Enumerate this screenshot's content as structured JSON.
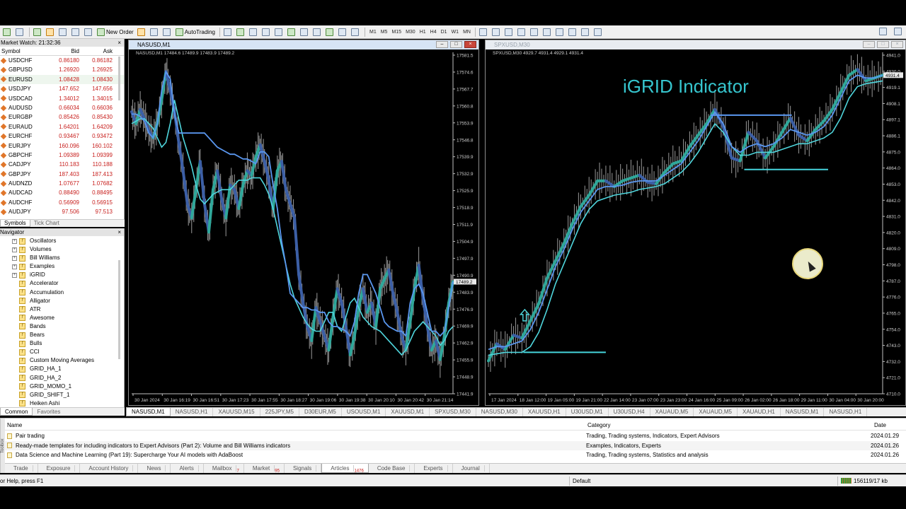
{
  "toolbar": {
    "new_order": "New Order",
    "auto_trading": "AutoTrading",
    "timeframes": [
      "M1",
      "M5",
      "M15",
      "M30",
      "H1",
      "H4",
      "D1",
      "W1",
      "MN"
    ]
  },
  "market_watch": {
    "title": "Market Watch: 21:32:36",
    "col_symbol": "Symbol",
    "col_bid": "Bid",
    "col_ask": "Ask",
    "rows": [
      {
        "symbol": "USDCHF",
        "bid": "0.86180",
        "ask": "0.86182"
      },
      {
        "symbol": "GBPUSD",
        "bid": "1.26920",
        "ask": "1.26925"
      },
      {
        "symbol": "EURUSD",
        "bid": "1.08428",
        "ask": "1.08430"
      },
      {
        "symbol": "USDJPY",
        "bid": "147.652",
        "ask": "147.656"
      },
      {
        "symbol": "USDCAD",
        "bid": "1.34012",
        "ask": "1.34015"
      },
      {
        "symbol": "AUDUSD",
        "bid": "0.66034",
        "ask": "0.66036"
      },
      {
        "symbol": "EURGBP",
        "bid": "0.85426",
        "ask": "0.85430"
      },
      {
        "symbol": "EURAUD",
        "bid": "1.64201",
        "ask": "1.64209"
      },
      {
        "symbol": "EURCHF",
        "bid": "0.93467",
        "ask": "0.93472"
      },
      {
        "symbol": "EURJPY",
        "bid": "160.096",
        "ask": "160.102"
      },
      {
        "symbol": "GBPCHF",
        "bid": "1.09389",
        "ask": "1.09399"
      },
      {
        "symbol": "CADJPY",
        "bid": "110.183",
        "ask": "110.188"
      },
      {
        "symbol": "GBPJPY",
        "bid": "187.403",
        "ask": "187.413"
      },
      {
        "symbol": "AUDNZD",
        "bid": "1.07677",
        "ask": "1.07682"
      },
      {
        "symbol": "AUDCAD",
        "bid": "0.88490",
        "ask": "0.88495"
      },
      {
        "symbol": "AUDCHF",
        "bid": "0.56909",
        "ask": "0.56915"
      },
      {
        "symbol": "AUDJPY",
        "bid": "97.506",
        "ask": "97.513"
      }
    ],
    "tabs": [
      "Symbols",
      "Tick Chart"
    ]
  },
  "navigator": {
    "title": "Navigator",
    "items": [
      {
        "label": "Oscillators",
        "expandable": true
      },
      {
        "label": "Volumes",
        "expandable": true
      },
      {
        "label": "Bill Williams",
        "expandable": true
      },
      {
        "label": "Examples",
        "expandable": true
      },
      {
        "label": "iGRID",
        "expandable": true
      },
      {
        "label": "Accelerator",
        "expandable": false
      },
      {
        "label": "Accumulation",
        "expandable": false
      },
      {
        "label": "Alligator",
        "expandable": false
      },
      {
        "label": "ATR",
        "expandable": false
      },
      {
        "label": "Awesome",
        "expandable": false
      },
      {
        "label": "Bands",
        "expandable": false
      },
      {
        "label": "Bears",
        "expandable": false
      },
      {
        "label": "Bulls",
        "expandable": false
      },
      {
        "label": "CCI",
        "expandable": false
      },
      {
        "label": "Custom Moving Averages",
        "expandable": false
      },
      {
        "label": "GRID_HA_1",
        "expandable": false
      },
      {
        "label": "GRID_HA_2",
        "expandable": false
      },
      {
        "label": "GRID_MOMO_1",
        "expandable": false
      },
      {
        "label": "GRID_SHIFT_1",
        "expandable": false
      },
      {
        "label": "Heiken Ashi",
        "expandable": false
      }
    ],
    "tabs": [
      "Common",
      "Favorites"
    ]
  },
  "chart_left": {
    "title": "NASUSD,M1",
    "info": "NASUSD,M1  17484.6 17489.9 17483.9 17489.2",
    "current_price_label": "17489.2"
  },
  "chart_right": {
    "title": "SPXUSD,M30",
    "info": "SPXUSD,M30  4929.7 4931.4 4929.1 4931.4",
    "overlay_label": "iGRID Indicator",
    "current_price_label": "4931.4"
  },
  "chart_data": [
    {
      "type": "line",
      "symbol": "NASUSD,M1",
      "ylim": [
        17441.5,
        17585
      ],
      "y_ticks": [
        "17581.5",
        "17574.6",
        "17567.7",
        "17560.8",
        "17553.9",
        "17546.8",
        "17539.9",
        "17532.9",
        "17525.9",
        "17518.9",
        "17511.9",
        "17504.9",
        "17497.9",
        "17490.9",
        "17483.9",
        "17476.9",
        "17469.9",
        "17462.9",
        "17455.9",
        "17448.9",
        "17441.9"
      ],
      "x_ticks": [
        "30 Jan 2024",
        "30 Jan 16:19",
        "30 Jan 16:51",
        "30 Jan 17:23",
        "30 Jan 17:55",
        "30 Jan 18:27",
        "30 Jan 19:06",
        "30 Jan 19:38",
        "30 Jan 20:10",
        "30 Jan 20:42",
        "30 Jan 21:14"
      ],
      "price_x": [
        0,
        6,
        12,
        18,
        24,
        30,
        36,
        42,
        48,
        54,
        60,
        66,
        72,
        78,
        84,
        90,
        96,
        102,
        108,
        114,
        120,
        126,
        132,
        138,
        144,
        150,
        156,
        162,
        168,
        174,
        180,
        186,
        192,
        198,
        204,
        210,
        216,
        222,
        228,
        234,
        240,
        246,
        252,
        258,
        264,
        270,
        276,
        282,
        288,
        294,
        300,
        306,
        312,
        318,
        324,
        330,
        336,
        342,
        348,
        354,
        360,
        366,
        372,
        378,
        384,
        390,
        396,
        402,
        408,
        414,
        420,
        426,
        432,
        438,
        444,
        450
      ],
      "price_y": [
        17561,
        17556,
        17562,
        17558,
        17553,
        17550,
        17556,
        17566,
        17578,
        17570,
        17561,
        17548,
        17536,
        17522,
        17516,
        17528,
        17540,
        17522,
        17510,
        17528,
        17536,
        17524,
        17516,
        17530,
        17528,
        17520,
        17530,
        17536,
        17534,
        17542,
        17547,
        17540,
        17532,
        17520,
        17536,
        17540,
        17528,
        17522,
        17516,
        17492,
        17480,
        17470,
        17464,
        17478,
        17472,
        17466,
        17460,
        17474,
        17486,
        17480,
        17470,
        17458,
        17466,
        17478,
        17486,
        17476,
        17480,
        17470,
        17486,
        17490,
        17494,
        17484,
        17476,
        17466,
        17460,
        17472,
        17486,
        17496,
        17482,
        17470,
        17460,
        17464,
        17456,
        17466,
        17480,
        17489
      ],
      "band_fast": [
        17560,
        17560,
        17559,
        17557,
        17552,
        17550,
        17556,
        17570,
        17578,
        17575,
        17560,
        17552,
        17552,
        17552,
        17552,
        17552,
        17552,
        17552,
        17550,
        17548,
        17546,
        17545,
        17544,
        17543,
        17543,
        17542,
        17541,
        17541,
        17540,
        17539,
        17544,
        17544,
        17542,
        17530,
        17520,
        17506,
        17496,
        17484,
        17482,
        17480,
        17478,
        17478,
        17477,
        17477,
        17476,
        17476,
        17472,
        17470,
        17470,
        17469,
        17468,
        17466,
        17472,
        17484,
        17492,
        17492,
        17488,
        17484,
        17478,
        17472,
        17470,
        17469,
        17468,
        17468,
        17466,
        17480,
        17486,
        17488,
        17484,
        17476,
        17468,
        17468,
        17466,
        17468,
        17478,
        17489
      ],
      "band_slow": [
        17556,
        17557,
        17558,
        17558,
        17556,
        17554,
        17550,
        17546,
        17548,
        17556,
        17566,
        17558,
        17550,
        17544,
        17538,
        17530,
        17524,
        17522,
        17524,
        17526,
        17527,
        17528,
        17528,
        17528,
        17530,
        17532,
        17532,
        17532,
        17533,
        17533,
        17533,
        17530,
        17526,
        17520,
        17512,
        17504,
        17496,
        17488,
        17482,
        17478,
        17474,
        17471,
        17469,
        17468,
        17468,
        17472,
        17476,
        17476,
        17470,
        17468,
        17474,
        17480,
        17482,
        17478,
        17474,
        17472,
        17470,
        17469,
        17468,
        17466,
        17464,
        17462,
        17460,
        17458,
        17460,
        17464,
        17468,
        17470,
        17472,
        17470,
        17468,
        17466,
        17462,
        17464,
        17468,
        17470
      ]
    },
    {
      "type": "line",
      "symbol": "SPXUSD,M30",
      "ylim": [
        4707,
        4944
      ],
      "y_ticks": [
        "4941.0",
        "4930.0",
        "4919.1",
        "4908.1",
        "4897.1",
        "4886.1",
        "4875.0",
        "4864.0",
        "4853.0",
        "4842.0",
        "4831.0",
        "4820.0",
        "4809.0",
        "4798.0",
        "4787.0",
        "4776.0",
        "4765.0",
        "4754.0",
        "4743.0",
        "4732.0",
        "4721.0",
        "4710.0"
      ],
      "x_ticks": [
        "17 Jan 2024",
        "18 Jan 12:00",
        "19 Jan 05:00",
        "19 Jan 21:00",
        "22 Jan 14:00",
        "23 Jan 07:00",
        "23 Jan 23:00",
        "24 Jan 16:00",
        "25 Jan 09:00",
        "26 Jan 02:00",
        "26 Jan 18:00",
        "29 Jan 11:00",
        "30 Jan 04:00",
        "30 Jan 20:00"
      ],
      "price_x": [
        0,
        12,
        24,
        36,
        48,
        60,
        72,
        84,
        96,
        108,
        120,
        132,
        144,
        156,
        168,
        180,
        192,
        204,
        216,
        228,
        240,
        252,
        264,
        276,
        288,
        300,
        312,
        324,
        336,
        348,
        360,
        372,
        384,
        396,
        408,
        420,
        432,
        444,
        456,
        468,
        480,
        492,
        504,
        516,
        528,
        540,
        552,
        564
      ],
      "price_y": [
        4730,
        4742,
        4738,
        4748,
        4746,
        4758,
        4770,
        4788,
        4800,
        4812,
        4826,
        4838,
        4846,
        4856,
        4856,
        4852,
        4856,
        4858,
        4860,
        4855,
        4854,
        4862,
        4868,
        4870,
        4880,
        4888,
        4896,
        4906,
        4894,
        4872,
        4870,
        4890,
        4884,
        4872,
        4880,
        4890,
        4900,
        4888,
        4884,
        4892,
        4898,
        4906,
        4918,
        4930,
        4934,
        4926,
        4928,
        4930
      ],
      "band_fast": [
        4738,
        4740,
        4740,
        4742,
        4744,
        4752,
        4764,
        4780,
        4796,
        4808,
        4822,
        4834,
        4842,
        4850,
        4852,
        4852,
        4853,
        4855,
        4856,
        4856,
        4856,
        4860,
        4864,
        4868,
        4876,
        4884,
        4894,
        4904,
        4896,
        4880,
        4876,
        4880,
        4882,
        4880,
        4882,
        4886,
        4892,
        4890,
        4888,
        4890,
        4894,
        4902,
        4914,
        4926,
        4930,
        4928,
        4928,
        4930
      ],
      "band_slow": [
        4734,
        4735,
        4736,
        4736,
        4736,
        4740,
        4750,
        4766,
        4784,
        4798,
        4812,
        4826,
        4836,
        4842,
        4844,
        4846,
        4847,
        4848,
        4850,
        4851,
        4852,
        4854,
        4858,
        4862,
        4868,
        4876,
        4886,
        4896,
        4890,
        4880,
        4874,
        4874,
        4876,
        4876,
        4876,
        4878,
        4880,
        4882,
        4882,
        4884,
        4886,
        4890,
        4900,
        4914,
        4922,
        4924,
        4925,
        4926
      ],
      "grid_lines": [
        {
          "y": 4902,
          "x_from": 318,
          "x_to": 434,
          "color": "#5a97f0"
        },
        {
          "y": 4864,
          "x_from": 366,
          "x_to": 486,
          "color": "#46d4dc"
        },
        {
          "y": 4736,
          "x_from": 50,
          "x_to": 168,
          "color": "#46d4dc"
        }
      ],
      "arrow": {
        "y": 4760,
        "x": 52
      }
    }
  ],
  "chart_tabs": [
    "NASUSD,M1",
    "NASUSD,H1",
    "XAUUSD,M15",
    "225JPY,M5",
    "D30EUR,M5",
    "USOUSD,M1",
    "XAUUSD,M1",
    "SPXUSD,M30",
    "NASUSD,M30",
    "XAUUSD,H1",
    "U30USD,M1",
    "U30USD,H4",
    "XAUAUD,M5",
    "XAUAUD,M5",
    "XAUAUD,H1",
    "NASUSD,M1",
    "NASUSD,H1"
  ],
  "toolbox": {
    "side_label": "Toolbox",
    "col_name": "Name",
    "col_category": "Category",
    "col_date": "Date",
    "articles": [
      {
        "name": "Pair trading",
        "category": "Trading, Trading systems, Indicators, Expert Advisors",
        "date": "2024.01.29"
      },
      {
        "name": "Ready-made templates for including indicators to Expert Advisors (Part 2): Volume and Bill Williams indicators",
        "category": "Examples, Indicators, Experts",
        "date": "2024.01.26"
      },
      {
        "name": "Data Science and Machine Learning (Part 19): Supercharge Your AI models with AdaBoost",
        "category": "Trading, Trading systems, Statistics and analysis",
        "date": "2024.01.26"
      }
    ],
    "tabs": [
      {
        "label": "Trade",
        "badge": ""
      },
      {
        "label": "Exposure",
        "badge": ""
      },
      {
        "label": "Account History",
        "badge": ""
      },
      {
        "label": "News",
        "badge": ""
      },
      {
        "label": "Alerts",
        "badge": ""
      },
      {
        "label": "Mailbox",
        "badge": "7"
      },
      {
        "label": "Market",
        "badge": "95"
      },
      {
        "label": "Signals",
        "badge": ""
      },
      {
        "label": "Articles",
        "badge": "1476"
      },
      {
        "label": "Code Base",
        "badge": ""
      },
      {
        "label": "Experts",
        "badge": ""
      },
      {
        "label": "Journal",
        "badge": ""
      }
    ],
    "active_tab": "Articles"
  },
  "status": {
    "help": "or Help, press F1",
    "profile": "Default",
    "traffic": "156119/17 kb"
  }
}
